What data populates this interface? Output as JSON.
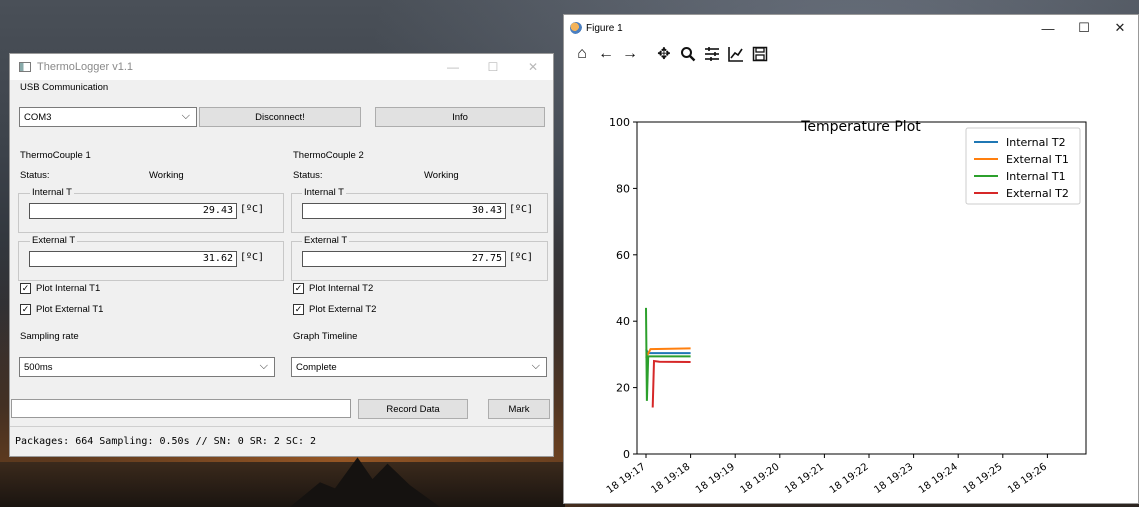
{
  "thermologger": {
    "title": "ThermoLogger v1.1",
    "controls": {
      "minimize": "—",
      "maximize": "☐",
      "close": "✕"
    },
    "usb": {
      "group_label": "USB Communication",
      "port": "COM3",
      "disconnect_label": "Disconnect!",
      "info_label": "Info"
    },
    "tc1": {
      "group_label": "ThermoCouple 1",
      "status_label": "Status:",
      "status_value": "Working",
      "internal_label": "Internal T",
      "internal_value": "29.43",
      "external_label": "External T",
      "external_value": "31.62",
      "unit": "[ºC]",
      "plot_internal_label": "Plot Internal T1",
      "plot_external_label": "Plot External T1"
    },
    "tc2": {
      "group_label": "ThermoCouple 2",
      "status_label": "Status:",
      "status_value": "Working",
      "internal_label": "Internal T",
      "internal_value": "30.43",
      "external_label": "External T",
      "external_value": "27.75",
      "unit": "[ºC]",
      "plot_internal_label": "Plot Internal T2",
      "plot_external_label": "Plot External T2"
    },
    "sampling": {
      "group_label": "Sampling rate",
      "value": "500ms"
    },
    "timeline": {
      "group_label": "Graph Timeline",
      "value": "Complete"
    },
    "record_label": "Record Data",
    "mark_label": "Mark",
    "status_text": "Packages: 664 Sampling: 0.50s // SN: 0 SR: 2 SC: 2"
  },
  "figure": {
    "title": "Figure 1",
    "controls": {
      "minimize": "—",
      "maximize": "☐",
      "close": "✕"
    },
    "toolbar": [
      "home-icon",
      "back-icon",
      "forward-icon",
      "pan-icon",
      "zoom-icon",
      "configure-icon",
      "edit-axis-icon",
      "save-icon"
    ]
  },
  "chart_data": {
    "type": "line",
    "title": "Temperature Plot",
    "xlabel": "",
    "ylabel": "",
    "ylim": [
      0,
      100
    ],
    "yticks": [
      0,
      20,
      40,
      60,
      80,
      100
    ],
    "xticks": [
      "18 19:17",
      "18 19:18",
      "18 19:19",
      "18 19:20",
      "18 19:21",
      "18 19:22",
      "18 19:23",
      "18 19:24",
      "18 19:25",
      "18 19:26"
    ],
    "legend_position": "top-right",
    "series": [
      {
        "name": "Internal T2",
        "color": "#1f77b4",
        "points": [
          [
            0,
            31.5
          ],
          [
            0.05,
            30.4
          ],
          [
            1.0,
            30.4
          ]
        ]
      },
      {
        "name": "External T1",
        "color": "#ff7f0e",
        "points": [
          [
            0,
            29
          ],
          [
            0.1,
            31.6
          ],
          [
            1.0,
            31.8
          ]
        ]
      },
      {
        "name": "Internal T1",
        "color": "#2ca02c",
        "points": [
          [
            0,
            44
          ],
          [
            0.02,
            16
          ],
          [
            0.05,
            29.4
          ],
          [
            1.0,
            29.4
          ]
        ]
      },
      {
        "name": "External T2",
        "color": "#d62728",
        "points": [
          [
            0.15,
            14
          ],
          [
            0.18,
            28
          ],
          [
            0.3,
            27.8
          ],
          [
            1.0,
            27.7
          ]
        ]
      }
    ]
  }
}
